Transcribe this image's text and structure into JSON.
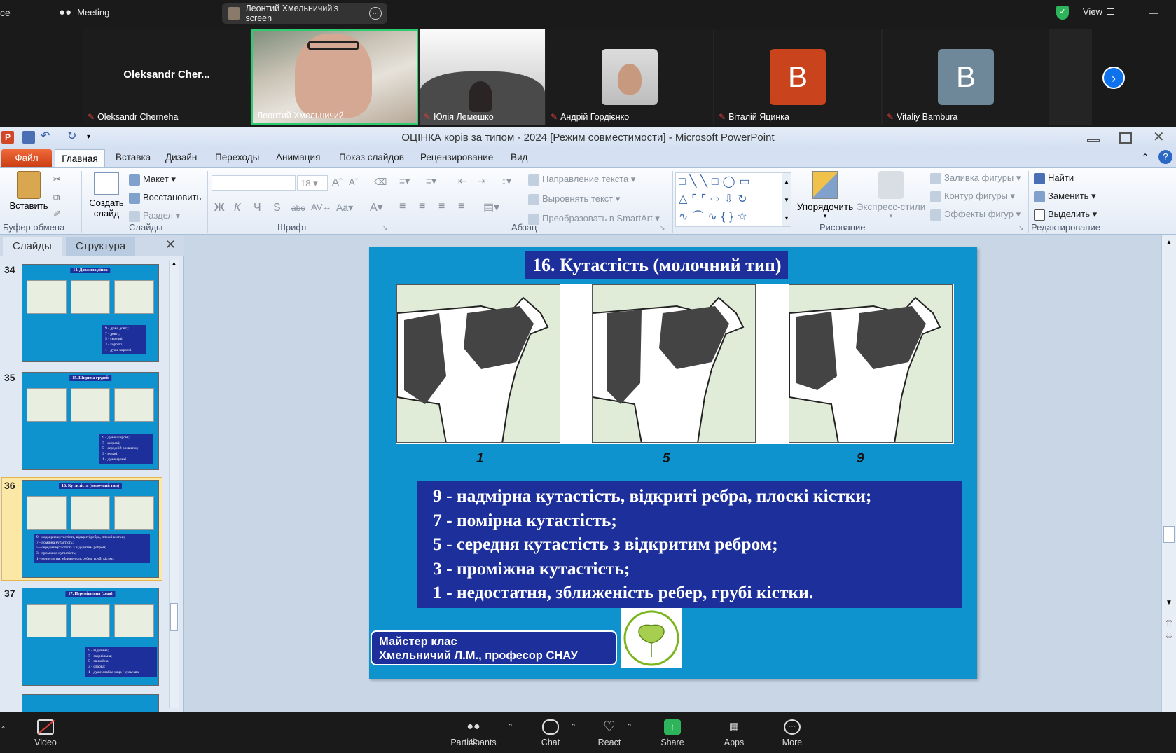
{
  "zoom": {
    "top": {
      "left_cut": "ce",
      "meeting_label": "Meeting",
      "screen_share_label": "Леонтий Хмельничий's screen",
      "view_label": "View"
    },
    "participants": [
      {
        "name": "Oleksandr Cherneha",
        "big_name": "Oleksandr  Cher...",
        "muted": true
      },
      {
        "name": "Леонтий Хмельничий",
        "muted": false
      },
      {
        "name": "Юлія Лемешко",
        "muted": true
      },
      {
        "name": "Андрій Гордієнко",
        "muted": true
      },
      {
        "name": "Віталій Яцинка",
        "initial": "B",
        "muted": true,
        "color": "#c9431c"
      },
      {
        "name": "Vitaliy Bambura",
        "initial": "B",
        "muted": true,
        "color": "#6f8899"
      }
    ],
    "bottom": {
      "video": "Video",
      "participants": "Participants",
      "participants_count": "12",
      "chat": "Chat",
      "react": "React",
      "share": "Share",
      "apps": "Apps",
      "more": "More"
    }
  },
  "ppt": {
    "window_title": "ОЦІНКА корів  за типом - 2024 [Режим совместимости] - Microsoft PowerPoint",
    "tabs": [
      "Файл",
      "Главная",
      "Вставка",
      "Дизайн",
      "Переходы",
      "Анимация",
      "Показ слайдов",
      "Рецензирование",
      "Вид"
    ],
    "ribbon": {
      "clipboard": {
        "paste": "Вставить",
        "label": "Буфер обмена"
      },
      "slides": {
        "layout": "Макет",
        "reset": "Восстановить",
        "section": "Раздел",
        "new_slide_1": "Создать",
        "new_slide_2": "слайд",
        "label": "Слайды"
      },
      "font": {
        "size": "18",
        "label": "Шрифт"
      },
      "paragraph": {
        "text_direction": "Направление текста",
        "align_text": "Выровнять текст",
        "smartart": "Преобразовать в SmartArt",
        "label": "Абзац"
      },
      "drawing": {
        "arrange": "Упорядочить",
        "quick_styles": "Экспресс-стили",
        "fill": "Заливка фигуры",
        "outline": "Контур фигуры",
        "effects": "Эффекты фигур",
        "label": "Рисование"
      },
      "editing": {
        "find": "Найти",
        "replace": "Заменить",
        "select": "Выделить",
        "label": "Редактирование"
      }
    },
    "pane_tabs": {
      "slides": "Слайды",
      "outline": "Структура"
    },
    "thumbnails": [
      {
        "num": "34",
        "title": "14. Довжина дійок",
        "lines": [
          "9 - дуже довгі;",
          "7 - довгі;",
          "5 - середні;",
          "3 - короткі;",
          "1 - дуже короткі."
        ]
      },
      {
        "num": "35",
        "title": "15. Ширина грудей",
        "lines": [
          "9 - дуже широкі;",
          "7 - широкі;",
          "5 - середній розвиток;",
          "3 - вузькі;",
          "1 - дуже вузькі."
        ]
      },
      {
        "num": "36",
        "title": "16. Кутастість (молочний тип)",
        "lines": [
          "9 - надмірна кутастість, відкриті ребра, плоскі кістки;",
          "7 - помірна кутастість;",
          "5 - середня кутастість з відкритим ребром;",
          "3 - проміжна кутастість;",
          "1 - недостатня, зближеність ребер, грубі кістки."
        ]
      },
      {
        "num": "37",
        "title": "17. Переміщення (хода)",
        "lines": [
          "9 - відмінна;",
          "7 - задовільна;",
          "5 - звичайна;",
          "3 - слабка;",
          "1 - дуже слабка хода / кульгава."
        ]
      }
    ],
    "slide": {
      "title": "16. Кутастість (молочний тип)",
      "scores": [
        "1",
        "5",
        "9"
      ],
      "lines": [
        "9 - надмірна кутастість, відкриті ребра, плоскі кістки;",
        "7 - помірна кутастість;",
        "5 - середня кутастість з відкритим ребром;",
        "3 - проміжна кутастість;",
        "1 - недостатня, зближеність ребер, грубі кістки."
      ],
      "footer_1": "Майстер клас",
      "footer_2": "Хмельничий Л.М., професор СНАУ"
    }
  }
}
